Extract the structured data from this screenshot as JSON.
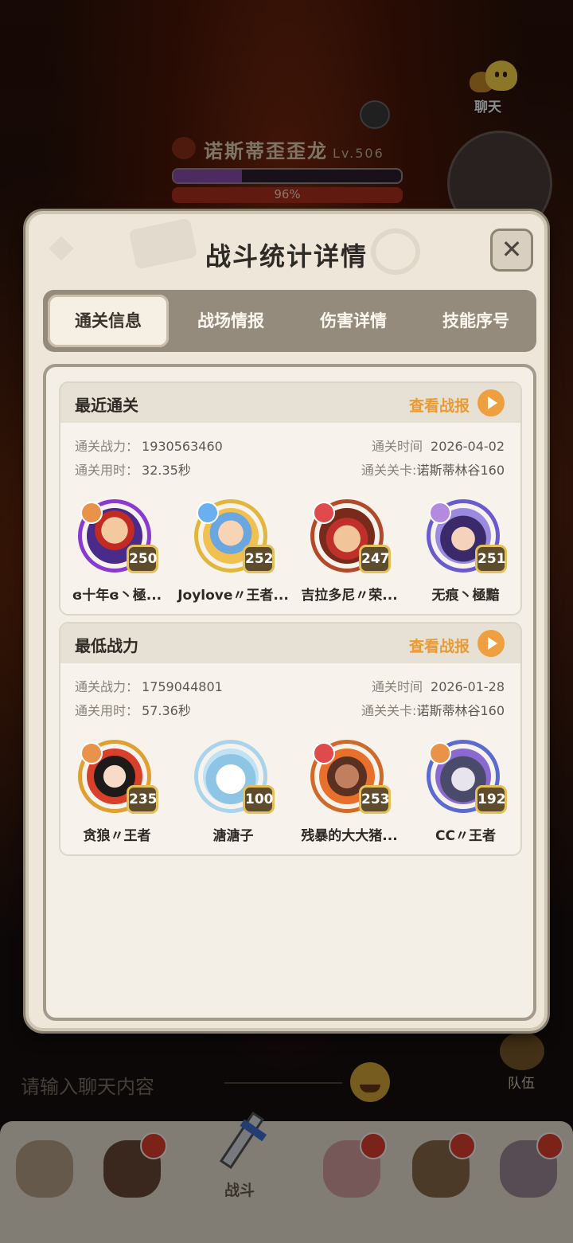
{
  "chat_button": {
    "label": "聊天"
  },
  "boss": {
    "name": "诺斯蒂歪歪龙",
    "level": "Lv.506",
    "hp": "96%"
  },
  "dialog": {
    "title": "战斗统计详情",
    "close": "✕",
    "tabs": [
      {
        "label": "通关信息"
      },
      {
        "label": "战场情报"
      },
      {
        "label": "伤害详情"
      },
      {
        "label": "技能序号"
      }
    ],
    "sections": [
      {
        "title": "最近通关",
        "report": "查看战报",
        "power_label": "通关战力：",
        "power": "1930563460",
        "time_label": "通关时间",
        "time": "2026-04-02",
        "duration_label": "通关用时：",
        "duration": "32.35秒",
        "stage_label": "通关关卡:",
        "stage": "诺斯蒂林谷160",
        "heroes": [
          {
            "level": "250",
            "name": "ɞ十年ɞ丶極..."
          },
          {
            "level": "252",
            "name": "Joylove〃王者..."
          },
          {
            "level": "247",
            "name": "吉拉多尼〃荣..."
          },
          {
            "level": "251",
            "name": "无痕丶極黯"
          }
        ]
      },
      {
        "title": "最低战力",
        "report": "查看战报",
        "power_label": "通关战力：",
        "power": "1759044801",
        "time_label": "通关时间",
        "time": "2026-01-28",
        "duration_label": "通关用时：",
        "duration": "57.36秒",
        "stage_label": "通关关卡:",
        "stage": "诺斯蒂林谷160",
        "heroes": [
          {
            "level": "235",
            "name": "贪狼〃王者"
          },
          {
            "level": "100",
            "name": "溏溏子"
          },
          {
            "level": "253",
            "name": "残暴的大大猪..."
          },
          {
            "level": "192",
            "name": "CC〃王者"
          }
        ]
      }
    ]
  },
  "chat_input": {
    "placeholder": "请输入聊天内容"
  },
  "team": {
    "label": "队伍"
  },
  "bottom_nav": {
    "battle_label": "战斗"
  },
  "colors": {
    "accent": "#e99a33",
    "tab_bar": "#958b7d",
    "panel": "#eee6d8"
  }
}
